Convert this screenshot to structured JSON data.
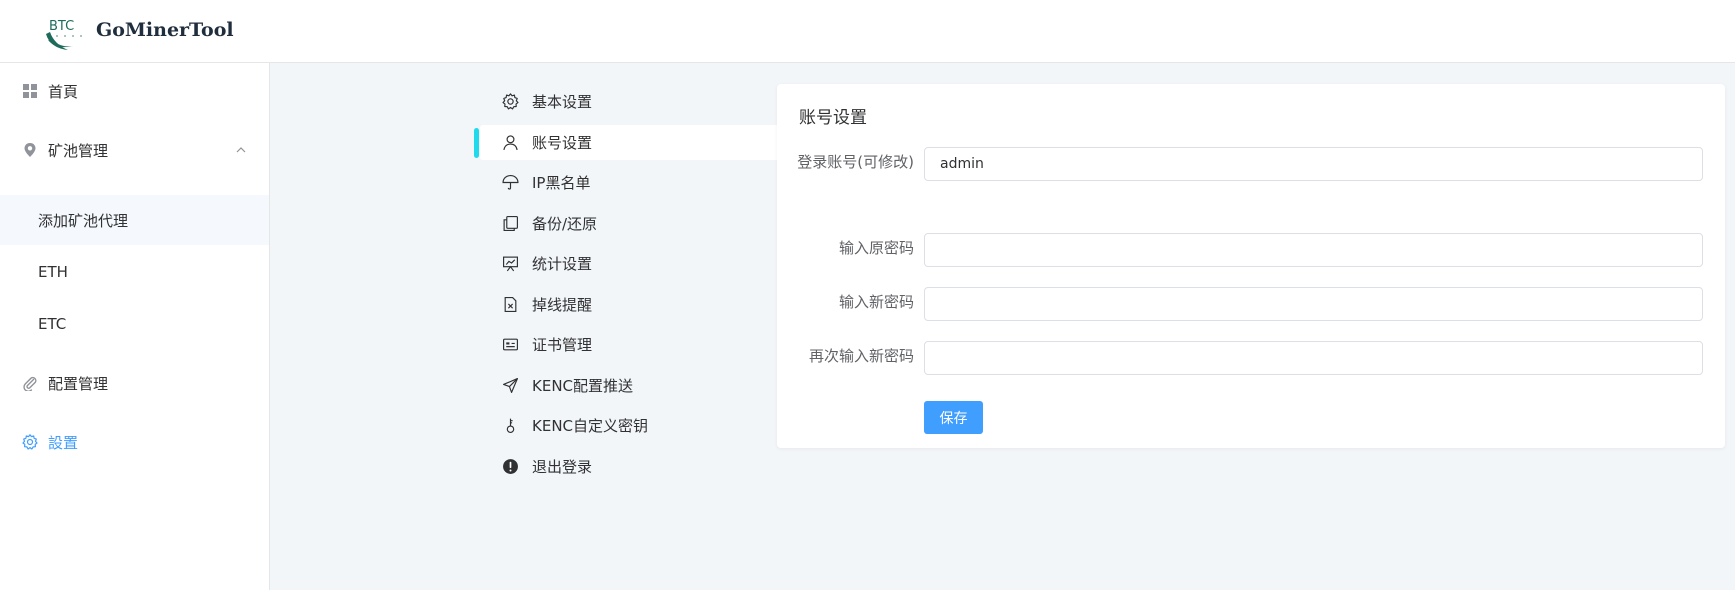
{
  "header": {
    "logo_text": "BTC",
    "brand": "GoMinerTool"
  },
  "sidebar": {
    "items": [
      {
        "label": "首頁",
        "icon": "grid-icon"
      },
      {
        "label": "矿池管理",
        "icon": "location-pin-icon",
        "expanded": true
      },
      {
        "label": "配置管理",
        "icon": "paperclip-icon"
      },
      {
        "label": "設置",
        "icon": "gear-icon",
        "active": true
      }
    ],
    "submenu": [
      {
        "label": "添加矿池代理"
      },
      {
        "label": "ETH"
      },
      {
        "label": "ETC"
      }
    ]
  },
  "settings_nav": {
    "items": [
      {
        "label": "基本设置",
        "icon": "gear-icon"
      },
      {
        "label": "账号设置",
        "icon": "user-icon",
        "selected": true
      },
      {
        "label": "IP黑名单",
        "icon": "umbrella-icon"
      },
      {
        "label": "备份/还原",
        "icon": "copy-icon"
      },
      {
        "label": "统计设置",
        "icon": "presentation-icon"
      },
      {
        "label": "掉线提醒",
        "icon": "document-x-icon"
      },
      {
        "label": "证书管理",
        "icon": "certificate-icon"
      },
      {
        "label": "KENC配置推送",
        "icon": "send-icon"
      },
      {
        "label": "KENC自定义密钥",
        "icon": "key-icon"
      },
      {
        "label": "退出登录",
        "icon": "warning-circle-icon"
      }
    ]
  },
  "account_form": {
    "title": "账号设置",
    "username_label": "登录账号(可修改)",
    "username_value": "admin",
    "old_password_label": "输入原密码",
    "new_password_label": "输入新密码",
    "confirm_password_label": "再次输入新密码",
    "save_label": "保存"
  },
  "colors": {
    "accent": "#409eff",
    "selected_marker": "#1fd9ec",
    "logo_green": "#1e6b5c",
    "main_bg": "#f3f6f9"
  }
}
